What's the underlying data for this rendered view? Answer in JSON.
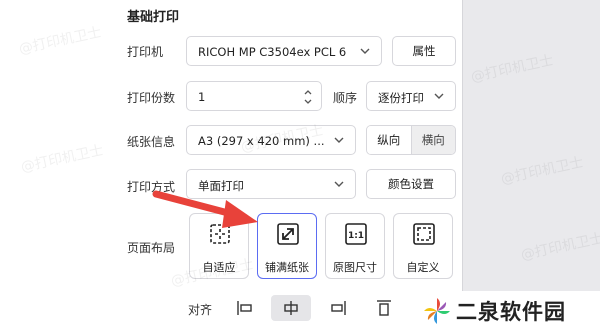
{
  "section_title": "基础打印",
  "printer": {
    "label": "打印机",
    "value": "RICOH MP C3504ex PCL 6",
    "properties_button": "属性"
  },
  "copies": {
    "label": "打印份数",
    "value": "1"
  },
  "order": {
    "label": "顺序",
    "value": "逐份打印"
  },
  "paper": {
    "label": "纸张信息",
    "value": "A3 (297 x 420 mm) ...",
    "portrait": "纵向",
    "landscape": "横向"
  },
  "print_mode": {
    "label": "打印方式",
    "value": "单面打印",
    "color_button": "颜色设置"
  },
  "layout": {
    "label": "页面布局",
    "options": [
      "自适应",
      "铺满纸张",
      "原图尺寸",
      "自定义"
    ],
    "selected": "铺满纸张"
  },
  "align": {
    "label": "对齐"
  },
  "watermark_text": "@打印机卫士",
  "brand": {
    "name": "二泉软件园"
  },
  "colors": {
    "accent": "#5b6cf2",
    "arrow": "#e8423a"
  },
  "icons": [
    "chevron-down-icon",
    "stepper-icon",
    "fit-icon",
    "fill-paper-icon",
    "original-size-icon",
    "custom-icon",
    "align-left-icon",
    "align-center-icon",
    "align-right-icon",
    "align-top-icon",
    "red-arrow-icon",
    "pinwheel-logo-icon"
  ]
}
